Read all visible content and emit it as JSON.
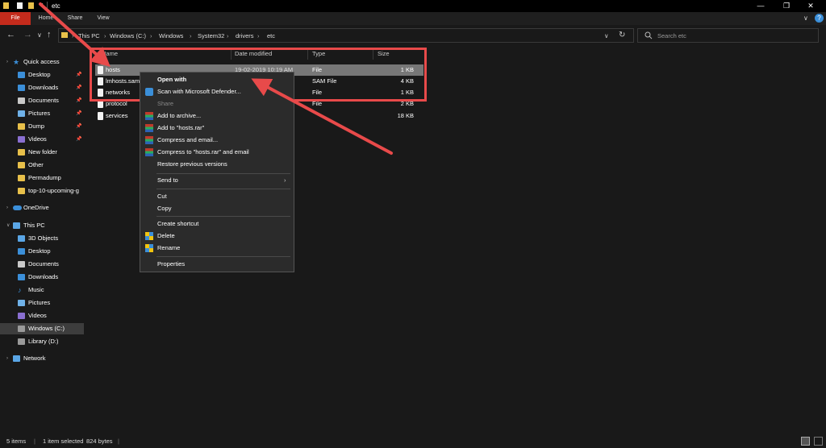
{
  "window": {
    "title": "etc",
    "minimize_icon": "minimize-icon",
    "maximize_icon": "maximize-icon",
    "close_icon": "close-icon"
  },
  "ribbon": {
    "tabs": [
      {
        "label": "File",
        "active": true
      },
      {
        "label": "Home"
      },
      {
        "label": "Share"
      },
      {
        "label": "View"
      }
    ],
    "help": "?"
  },
  "address": {
    "crumbs": [
      "This PC",
      "Windows (C:)",
      "Windows",
      "System32",
      "drivers",
      "etc"
    ],
    "search_placeholder": "Search etc"
  },
  "sidebar": {
    "quick_access": "Quick access",
    "pinned": [
      {
        "label": "Desktop",
        "icon": "desktop-icon"
      },
      {
        "label": "Downloads",
        "icon": "downloads-icon"
      },
      {
        "label": "Documents",
        "icon": "documents-icon"
      },
      {
        "label": "Pictures",
        "icon": "pictures-icon"
      },
      {
        "label": "Dump",
        "icon": "folder-icon"
      },
      {
        "label": "Videos",
        "icon": "videos-icon"
      },
      {
        "label": "New folder",
        "icon": "folder-icon"
      },
      {
        "label": "Other",
        "icon": "folder-icon"
      },
      {
        "label": "Permadump",
        "icon": "folder-icon"
      },
      {
        "label": "top-10-upcoming-g",
        "icon": "folder-icon"
      }
    ],
    "onedrive": "OneDrive",
    "this_pc": "This PC",
    "pc_items": [
      {
        "label": "3D Objects"
      },
      {
        "label": "Desktop"
      },
      {
        "label": "Documents"
      },
      {
        "label": "Downloads"
      },
      {
        "label": "Music"
      },
      {
        "label": "Pictures"
      },
      {
        "label": "Videos"
      },
      {
        "label": "Windows (C:)"
      },
      {
        "label": "Library (D:)"
      }
    ],
    "network": "Network"
  },
  "filelist": {
    "columns": [
      "Name",
      "Date modified",
      "Type",
      "Size"
    ],
    "rows": [
      {
        "name": "hosts",
        "date": "19-02-2019 10:19 AM",
        "type": "File",
        "size": "1 KB"
      },
      {
        "name": "lmhosts.sam",
        "date": "",
        "type": "SAM File",
        "size": "4 KB"
      },
      {
        "name": "networks",
        "date": "",
        "type": "File",
        "size": "1 KB"
      },
      {
        "name": "protocol",
        "date": "",
        "type": "File",
        "size": "2 KB"
      },
      {
        "name": "services",
        "date": "",
        "type": "File",
        "size": "18 KB"
      }
    ]
  },
  "context_menu": {
    "open_with": "Open with",
    "scan": "Scan with Microsoft Defender...",
    "share": "Share",
    "add_archive": "Add to archive...",
    "add_hosts_rar": "Add to \"hosts.rar\"",
    "compress_email": "Compress and email...",
    "compress_hosts_email": "Compress to \"hosts.rar\" and email",
    "restore": "Restore previous versions",
    "send_to": "Send to",
    "cut": "Cut",
    "copy": "Copy",
    "create_shortcut": "Create shortcut",
    "delete": "Delete",
    "rename": "Rename",
    "properties": "Properties"
  },
  "status": {
    "items": "5 items",
    "selected": "1 item selected",
    "size": "824 bytes"
  },
  "colors": {
    "accent_red": "#e84a4a",
    "file_tab": "#c42b1c",
    "folder_yellow": "#e8c04a",
    "blue": "#3b8fd9"
  }
}
